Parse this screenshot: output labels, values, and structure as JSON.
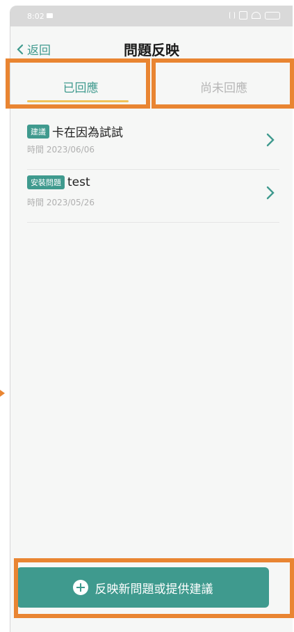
{
  "status_bar": {
    "time": "8:02"
  },
  "header": {
    "back_label": "返回",
    "title": "問題反映"
  },
  "tabs": [
    {
      "label": "已回應",
      "active": true
    },
    {
      "label": "尚未回應",
      "active": false
    }
  ],
  "items": [
    {
      "tag": "建議",
      "title": "卡在因為試試",
      "time": "時間 2023/06/06"
    },
    {
      "tag": "安裝問題",
      "title": "test",
      "time": "時間 2023/05/26"
    }
  ],
  "bottom_button": {
    "label": "反映新問題或提供建議"
  },
  "colors": {
    "accent": "#3f9a8e",
    "tab_underline": "#f0c35a",
    "highlight": "#e98532"
  }
}
